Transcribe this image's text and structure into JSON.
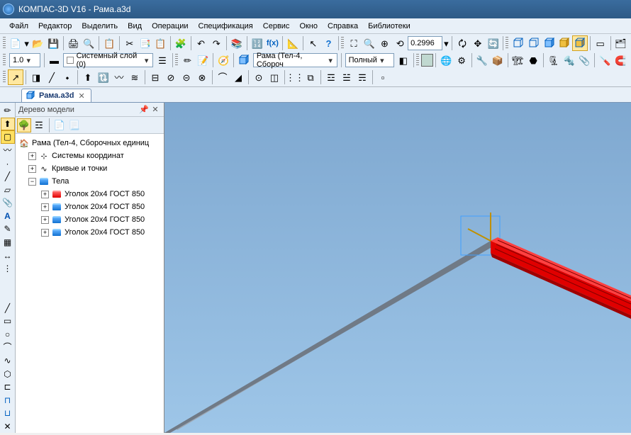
{
  "app": {
    "title": "КОМПАС-3D V16  - Рама.a3d"
  },
  "menu": {
    "items": [
      "Файл",
      "Редактор",
      "Выделить",
      "Вид",
      "Операции",
      "Спецификация",
      "Сервис",
      "Окно",
      "Справка",
      "Библиотеки"
    ]
  },
  "toolbar2": {
    "weight": "1.0",
    "layer_label": "Системный слой (0)",
    "body_label": "Рама (Тел-4, Сбороч",
    "shading_label": "Полный"
  },
  "zoom": {
    "value": "0.2996"
  },
  "doc_tab": {
    "label": "Рама.a3d"
  },
  "tree": {
    "title": "Дерево модели",
    "root": "Рама (Тел-4, Сборочных единиц",
    "nodes": {
      "coords": "Системы координат",
      "curves": "Кривые и точки",
      "bodies": "Тела",
      "u1": "Уголок  20x4 ГОСТ 850",
      "u2": "Уголок  20x4 ГОСТ 850",
      "u3": "Уголок  20x4 ГОСТ 850",
      "u4": "Уголок  20x4 ГОСТ 850"
    }
  },
  "icons": {
    "new": "new",
    "open": "open",
    "save": "save",
    "print": "print",
    "preview": "preview",
    "cut": "cut",
    "copy": "copy",
    "paste": "paste",
    "undo": "undo",
    "redo": "redo",
    "props": "props",
    "vars": "vars",
    "fx": "fx",
    "help": "help",
    "arrow": "arrow",
    "zoomfit": "fit",
    "zoomwin": "win",
    "zoomin": "in",
    "zoomprev": "prev",
    "refresh": "refresh",
    "rotate": "rotate",
    "move": "move",
    "cube1": "c1",
    "cube2": "c2",
    "cube3": "c3",
    "cube4": "c4",
    "cube5": "c5",
    "cube6": "c6",
    "cube7": "c7",
    "pin": "pin",
    "close": "close"
  }
}
